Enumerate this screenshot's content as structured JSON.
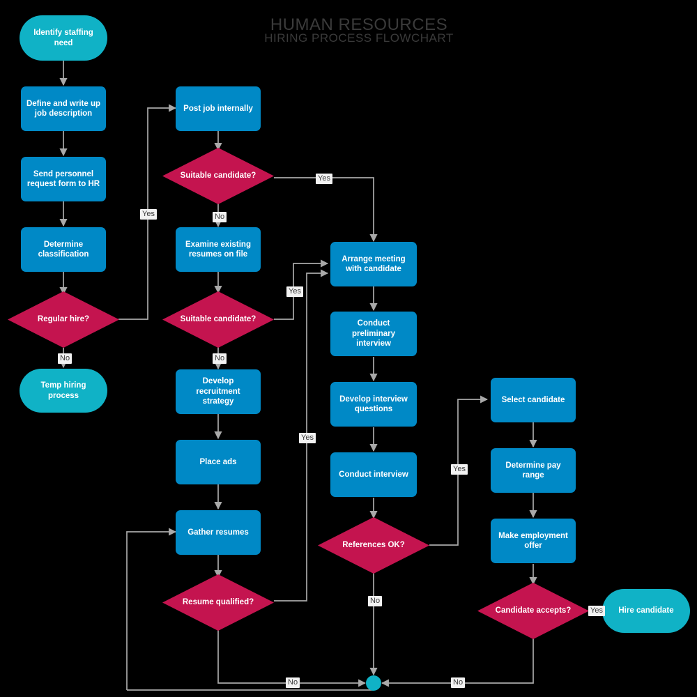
{
  "title": {
    "line1": "HUMAN RESOURCES",
    "line2": "HIRING PROCESS FLOWCHART"
  },
  "colors": {
    "background": "#000000",
    "terminator": "#10b2c6",
    "process": "#0089c6",
    "decision": "#c4144f",
    "connector": "#a9a9a9",
    "label_text": "#3a3a3a",
    "label_bg": "#f2f2f2",
    "title_text": "#3b3b3b",
    "node_text": "#ffffff"
  },
  "nodes": {
    "identify_staffing_need": {
      "label": "Identify staffing need",
      "type": "terminator"
    },
    "define_job_description": {
      "label": "Define and write up job description",
      "type": "process"
    },
    "send_personnel_request": {
      "label": "Send personnel request form to HR",
      "type": "process"
    },
    "determine_classification": {
      "label": "Determine classification",
      "type": "process"
    },
    "regular_hire": {
      "label": "Regular hire?",
      "type": "decision"
    },
    "temp_hiring_process": {
      "label": "Temp hiring process",
      "type": "terminator"
    },
    "post_job_internally": {
      "label": "Post job internally",
      "type": "process"
    },
    "suitable_candidate_1": {
      "label": "Suitable candidate?",
      "type": "decision"
    },
    "examine_existing_resumes": {
      "label": "Examine existing resumes on file",
      "type": "process"
    },
    "suitable_candidate_2": {
      "label": "Suitable candidate?",
      "type": "decision"
    },
    "develop_recruitment_strategy": {
      "label": "Develop recruitment strategy",
      "type": "process"
    },
    "place_ads": {
      "label": "Place ads",
      "type": "process"
    },
    "gather_resumes": {
      "label": "Gather resumes",
      "type": "process"
    },
    "resume_qualified": {
      "label": "Resume qualified?",
      "type": "decision"
    },
    "arrange_meeting": {
      "label": "Arrange meeting with candidate",
      "type": "process"
    },
    "conduct_preliminary_interview": {
      "label": "Conduct preliminary interview",
      "type": "process"
    },
    "develop_interview_questions": {
      "label": "Develop interview questions",
      "type": "process"
    },
    "conduct_interview": {
      "label": "Conduct interview",
      "type": "process"
    },
    "references_ok": {
      "label": "References OK?",
      "type": "decision"
    },
    "select_candidate": {
      "label": "Select candidate",
      "type": "process"
    },
    "determine_pay_range": {
      "label": "Determine pay range",
      "type": "process"
    },
    "make_employment_offer": {
      "label": "Make employment offer",
      "type": "process"
    },
    "candidate_accepts": {
      "label": "Candidate accepts?",
      "type": "decision"
    },
    "hire_candidate": {
      "label": "Hire candidate",
      "type": "terminator"
    },
    "junction": {
      "label": "",
      "type": "connector-dot"
    }
  },
  "edge_labels": {
    "regular_hire_yes": "Yes",
    "regular_hire_no": "No",
    "suitable_1_yes": "Yes",
    "suitable_1_no": "No",
    "suitable_2_yes": "Yes",
    "suitable_2_no": "No",
    "resume_qualified_yes": "Yes",
    "resume_qualified_no": "No",
    "references_ok_yes": "Yes",
    "references_ok_no": "No",
    "candidate_accepts_yes": "Yes",
    "candidate_accepts_no": "No"
  }
}
